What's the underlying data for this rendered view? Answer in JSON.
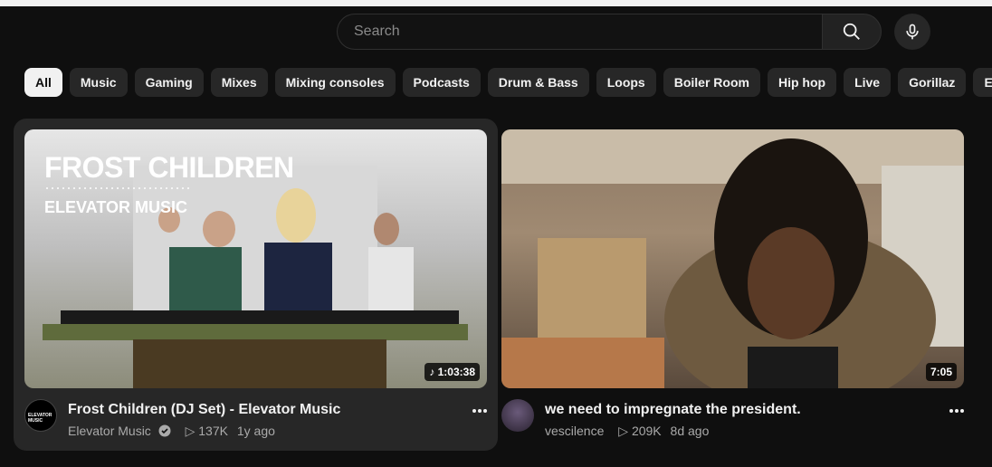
{
  "search": {
    "placeholder": "Search"
  },
  "chips": [
    "All",
    "Music",
    "Gaming",
    "Mixes",
    "Mixing consoles",
    "Podcasts",
    "Drum & Bass",
    "Loops",
    "Boiler Room",
    "Hip hop",
    "Live",
    "Gorillaz",
    "E"
  ],
  "videos": [
    {
      "thumb_title": "FROST CHILDREN",
      "thumb_sub": "ELEVATOR MUSIC",
      "duration": "1:03:38",
      "title": "Frost Children (DJ Set) - Elevator Music",
      "channel": "Elevator Music",
      "views": "137K",
      "age": "1y ago",
      "avatar_text": "ELEVATOR MUSIC"
    },
    {
      "duration": "7:05",
      "title": "we need to impregnate the president.",
      "channel": "vescilence",
      "views": "209K",
      "age": "8d ago"
    }
  ]
}
